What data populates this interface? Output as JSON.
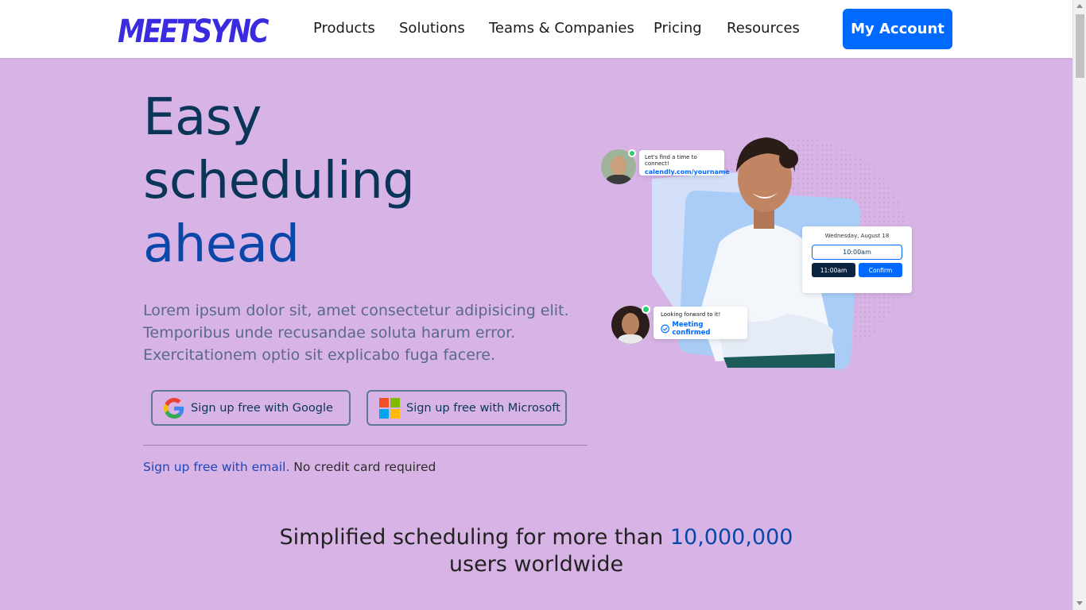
{
  "header": {
    "logo": "MEETSYNC",
    "nav": [
      "Products",
      "Solutions",
      "Teams & Companies",
      "Pricing",
      "Resources"
    ],
    "account_button": "My Account"
  },
  "hero": {
    "title_lines": [
      "Easy",
      "scheduling",
      "ahead"
    ],
    "description": "Lorem ipsum dolor sit, amet consectetur adipisicing elit. Temporibus unde recusandae soluta harum error. Exercitationem optio sit explicabo fuga facere.",
    "google_button": "Sign up free with Google",
    "microsoft_button": "Sign up free with Microsoft",
    "email_link": "Sign up free with email.",
    "email_note": " No credit card required"
  },
  "illustration": {
    "chat1_text": "Let's find a time to connect!",
    "chat1_link": "calendly.com/yourname",
    "date_label": "Wednesday, August 18",
    "slot1": "10:00am",
    "slot2": "11:00am",
    "confirm": "Confirm",
    "chat2_text": "Looking forward to it!",
    "chat2_status": "Meeting confirmed"
  },
  "stats": {
    "before": "Simplified scheduling for more than ",
    "number": "10,000,000",
    "after": "users worldwide"
  },
  "colors": {
    "background": "#d8b4e6",
    "brand": "#0069ff",
    "heading": "#0b3558",
    "accent": "#0a47a9"
  }
}
